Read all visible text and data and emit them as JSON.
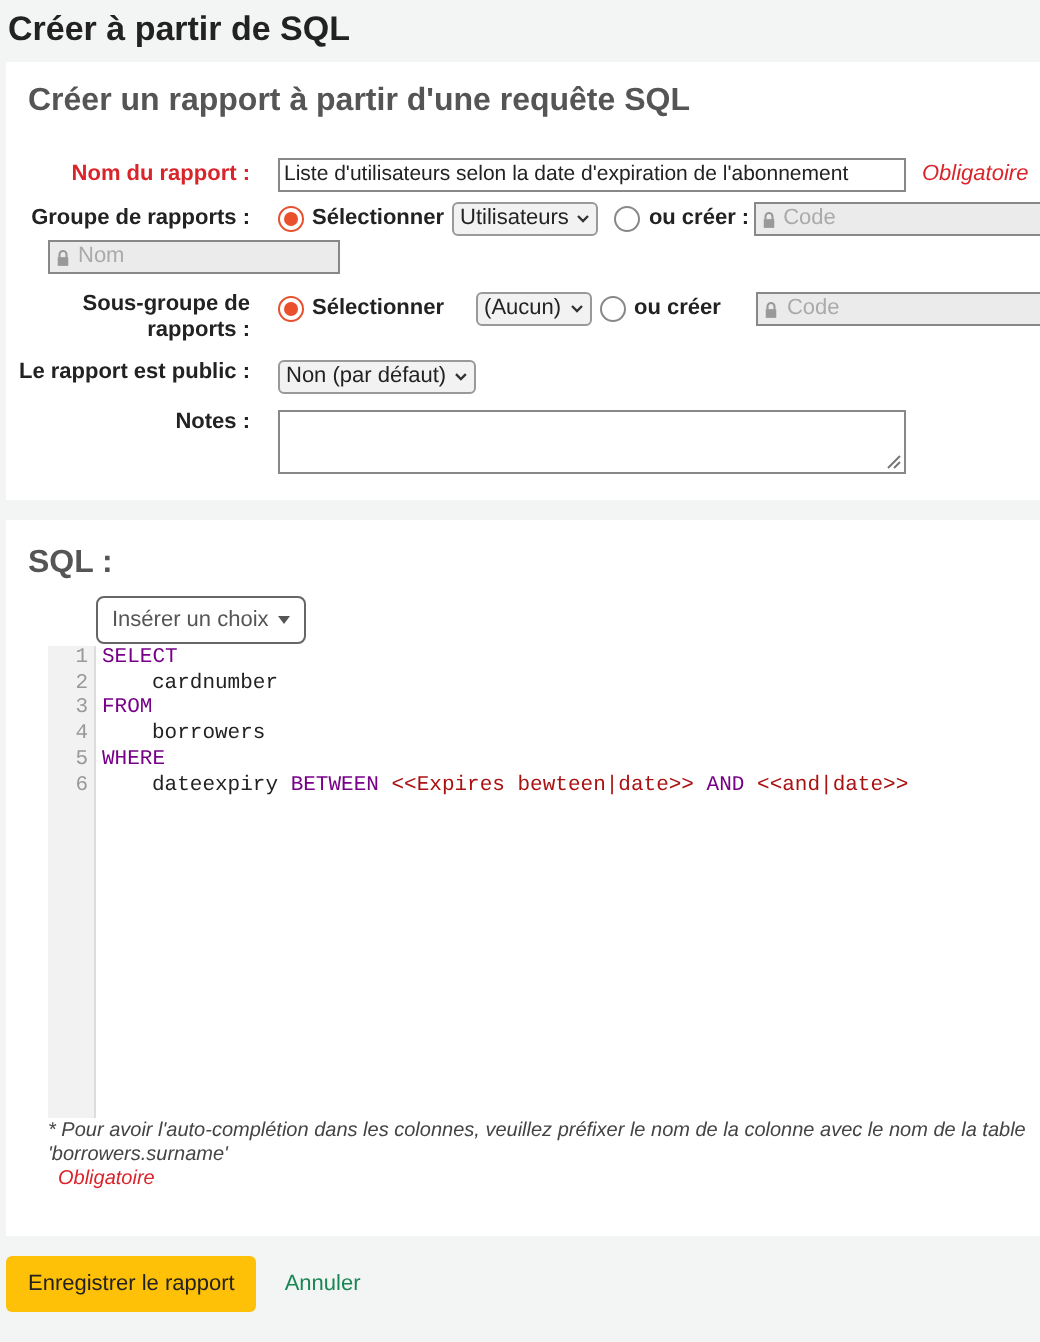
{
  "page_title": "Créer à partir de SQL",
  "form": {
    "title": "Créer un rapport à partir d'une requête SQL",
    "name": {
      "label": "Nom du rapport :",
      "value": "Liste d'utilisateurs selon la date d'expiration de l'abonnement",
      "required": "Obligatoire"
    },
    "group": {
      "label": "Groupe de rapports :",
      "options": [
        {
          "label": "Sélectionner",
          "selected": true
        },
        {
          "label": "ou créer :",
          "selected": false
        }
      ],
      "select": "Utilisateurs",
      "code_placeholder": "Code",
      "name_placeholder": "Nom"
    },
    "subgroup": {
      "label": "Sous-groupe de rapports :",
      "options": [
        {
          "label": "Sélectionner",
          "selected": true
        },
        {
          "label": "ou créer",
          "selected": false
        }
      ],
      "select": "(Aucun)",
      "code_placeholder": "Code"
    },
    "public": {
      "label": "Le rapport est public :",
      "select": "Non (par défaut)"
    },
    "notes": {
      "label": "Notes :"
    }
  },
  "sql": {
    "title": "SQL :",
    "insert_button": "Insérer un choix",
    "lines": [
      {
        "number": "1",
        "indented": false,
        "tokens": [
          {
            "kind": "keyword",
            "text": "SELECT"
          }
        ]
      },
      {
        "number": "2",
        "indented": true,
        "tokens": [
          {
            "kind": "plain",
            "text": "cardnumber"
          }
        ]
      },
      {
        "number": "3",
        "indented": false,
        "tokens": [
          {
            "kind": "keyword",
            "text": "FROM"
          }
        ]
      },
      {
        "number": "4",
        "indented": true,
        "tokens": [
          {
            "kind": "plain",
            "text": "borrowers"
          }
        ]
      },
      {
        "number": "5",
        "indented": false,
        "tokens": [
          {
            "kind": "keyword",
            "text": "WHERE"
          }
        ]
      },
      {
        "number": "6",
        "indented": true,
        "tokens": [
          {
            "kind": "plain",
            "text": "dateexpiry"
          },
          {
            "kind": "keyword",
            "text": "BETWEEN"
          },
          {
            "kind": "string",
            "text": "<<Expires bewteen|date>>"
          },
          {
            "kind": "keyword",
            "text": "AND"
          },
          {
            "kind": "string",
            "text": "<<and|date>>"
          }
        ]
      }
    ],
    "note_lines": [
      "* Pour avoir l'auto-complétion dans les colonnes, veuillez préfixer le nom de la colonne avec le nom de la table",
      "'borrowers.surname'"
    ],
    "required": "Obligatoire"
  },
  "actions": {
    "save": "Enregistrer le rapport",
    "cancel": "Annuler"
  }
}
